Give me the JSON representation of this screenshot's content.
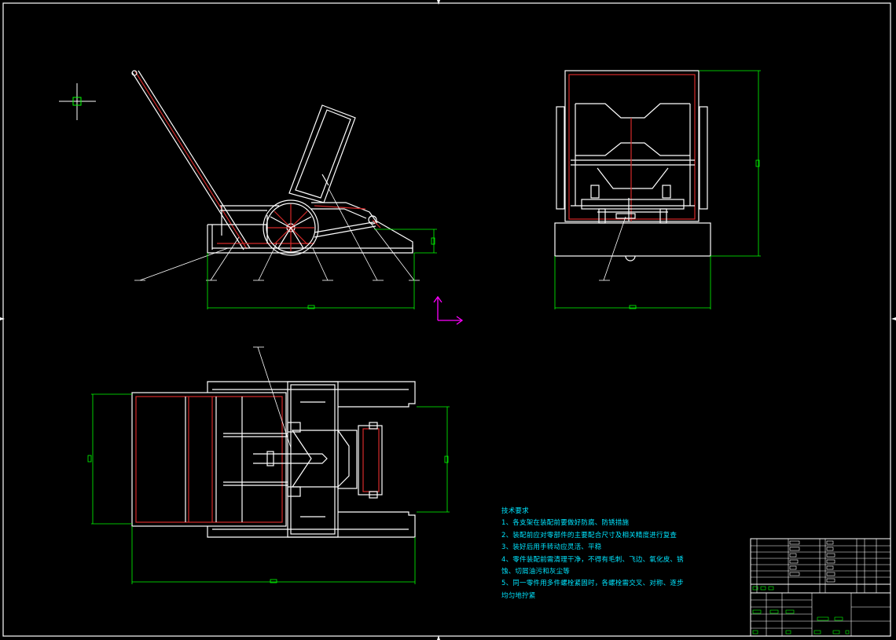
{
  "drawing": {
    "notes": {
      "heading": "技术要求",
      "lines": [
        "1、各支架在装配前要做好防腐、防锈措施",
        "2、装配前应对零部件的主要配合尺寸及相关精度进行复查",
        "3、装好后用手转动应灵活、平稳",
        "4、零件装配前需清理干净，不得有毛刺、飞边、氧化皮、锈",
        "蚀、切屑油污和灰尘等",
        "5、同一零件用多件螺栓紧固时，各螺栓需交叉、对称、逐步",
        "均匀地拧紧"
      ]
    },
    "colors": {
      "background": "#000000",
      "outline": "#ffffff",
      "hidden": "#d42a2a",
      "dimension": "#00ff00",
      "note_text": "#00e5ff",
      "axis_indicator": "#ff00ff"
    }
  }
}
